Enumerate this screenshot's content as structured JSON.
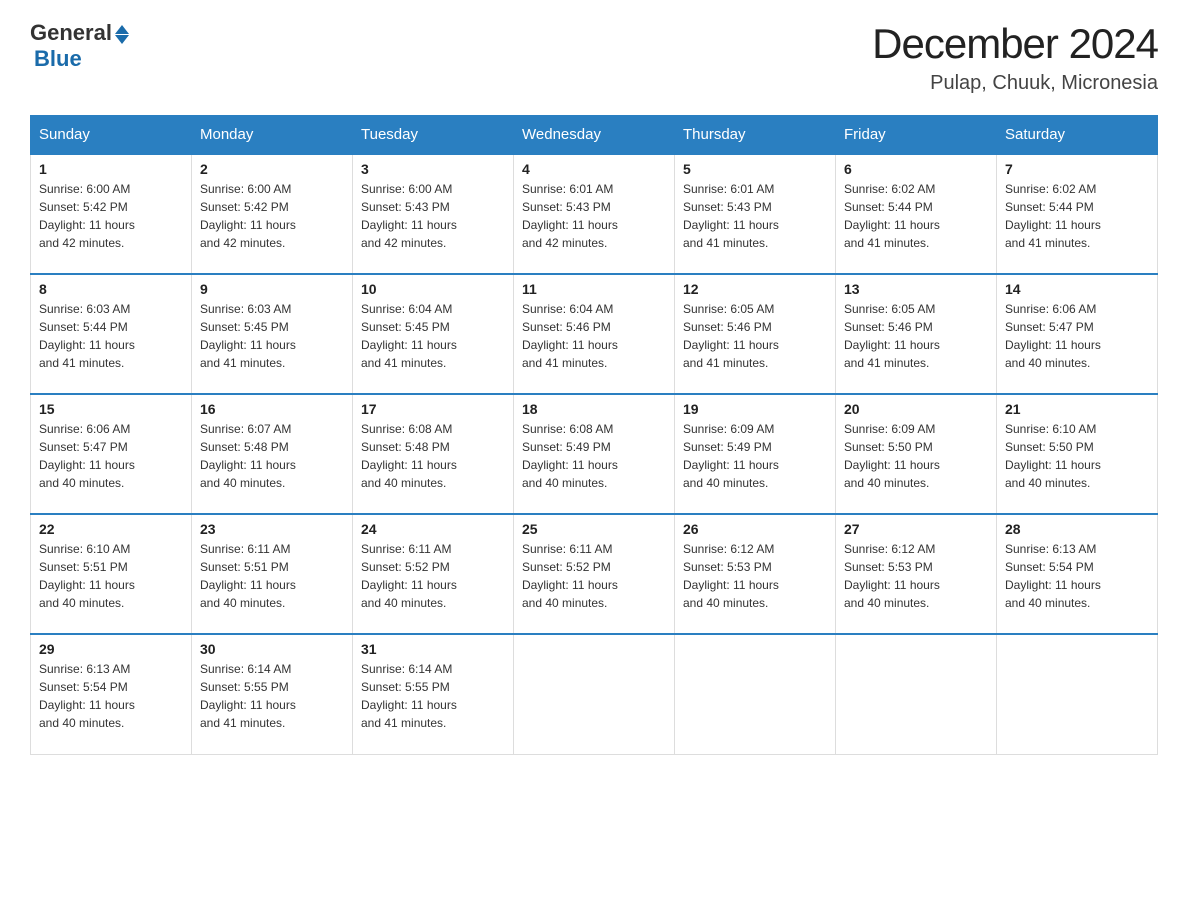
{
  "header": {
    "logo_general": "General",
    "logo_blue": "Blue",
    "month_title": "December 2024",
    "location": "Pulap, Chuuk, Micronesia"
  },
  "weekdays": [
    "Sunday",
    "Monday",
    "Tuesday",
    "Wednesday",
    "Thursday",
    "Friday",
    "Saturday"
  ],
  "weeks": [
    [
      {
        "day": "1",
        "sunrise": "6:00 AM",
        "sunset": "5:42 PM",
        "daylight": "11 hours and 42 minutes."
      },
      {
        "day": "2",
        "sunrise": "6:00 AM",
        "sunset": "5:42 PM",
        "daylight": "11 hours and 42 minutes."
      },
      {
        "day": "3",
        "sunrise": "6:00 AM",
        "sunset": "5:43 PM",
        "daylight": "11 hours and 42 minutes."
      },
      {
        "day": "4",
        "sunrise": "6:01 AM",
        "sunset": "5:43 PM",
        "daylight": "11 hours and 42 minutes."
      },
      {
        "day": "5",
        "sunrise": "6:01 AM",
        "sunset": "5:43 PM",
        "daylight": "11 hours and 41 minutes."
      },
      {
        "day": "6",
        "sunrise": "6:02 AM",
        "sunset": "5:44 PM",
        "daylight": "11 hours and 41 minutes."
      },
      {
        "day": "7",
        "sunrise": "6:02 AM",
        "sunset": "5:44 PM",
        "daylight": "11 hours and 41 minutes."
      }
    ],
    [
      {
        "day": "8",
        "sunrise": "6:03 AM",
        "sunset": "5:44 PM",
        "daylight": "11 hours and 41 minutes."
      },
      {
        "day": "9",
        "sunrise": "6:03 AM",
        "sunset": "5:45 PM",
        "daylight": "11 hours and 41 minutes."
      },
      {
        "day": "10",
        "sunrise": "6:04 AM",
        "sunset": "5:45 PM",
        "daylight": "11 hours and 41 minutes."
      },
      {
        "day": "11",
        "sunrise": "6:04 AM",
        "sunset": "5:46 PM",
        "daylight": "11 hours and 41 minutes."
      },
      {
        "day": "12",
        "sunrise": "6:05 AM",
        "sunset": "5:46 PM",
        "daylight": "11 hours and 41 minutes."
      },
      {
        "day": "13",
        "sunrise": "6:05 AM",
        "sunset": "5:46 PM",
        "daylight": "11 hours and 41 minutes."
      },
      {
        "day": "14",
        "sunrise": "6:06 AM",
        "sunset": "5:47 PM",
        "daylight": "11 hours and 40 minutes."
      }
    ],
    [
      {
        "day": "15",
        "sunrise": "6:06 AM",
        "sunset": "5:47 PM",
        "daylight": "11 hours and 40 minutes."
      },
      {
        "day": "16",
        "sunrise": "6:07 AM",
        "sunset": "5:48 PM",
        "daylight": "11 hours and 40 minutes."
      },
      {
        "day": "17",
        "sunrise": "6:08 AM",
        "sunset": "5:48 PM",
        "daylight": "11 hours and 40 minutes."
      },
      {
        "day": "18",
        "sunrise": "6:08 AM",
        "sunset": "5:49 PM",
        "daylight": "11 hours and 40 minutes."
      },
      {
        "day": "19",
        "sunrise": "6:09 AM",
        "sunset": "5:49 PM",
        "daylight": "11 hours and 40 minutes."
      },
      {
        "day": "20",
        "sunrise": "6:09 AM",
        "sunset": "5:50 PM",
        "daylight": "11 hours and 40 minutes."
      },
      {
        "day": "21",
        "sunrise": "6:10 AM",
        "sunset": "5:50 PM",
        "daylight": "11 hours and 40 minutes."
      }
    ],
    [
      {
        "day": "22",
        "sunrise": "6:10 AM",
        "sunset": "5:51 PM",
        "daylight": "11 hours and 40 minutes."
      },
      {
        "day": "23",
        "sunrise": "6:11 AM",
        "sunset": "5:51 PM",
        "daylight": "11 hours and 40 minutes."
      },
      {
        "day": "24",
        "sunrise": "6:11 AM",
        "sunset": "5:52 PM",
        "daylight": "11 hours and 40 minutes."
      },
      {
        "day": "25",
        "sunrise": "6:11 AM",
        "sunset": "5:52 PM",
        "daylight": "11 hours and 40 minutes."
      },
      {
        "day": "26",
        "sunrise": "6:12 AM",
        "sunset": "5:53 PM",
        "daylight": "11 hours and 40 minutes."
      },
      {
        "day": "27",
        "sunrise": "6:12 AM",
        "sunset": "5:53 PM",
        "daylight": "11 hours and 40 minutes."
      },
      {
        "day": "28",
        "sunrise": "6:13 AM",
        "sunset": "5:54 PM",
        "daylight": "11 hours and 40 minutes."
      }
    ],
    [
      {
        "day": "29",
        "sunrise": "6:13 AM",
        "sunset": "5:54 PM",
        "daylight": "11 hours and 40 minutes."
      },
      {
        "day": "30",
        "sunrise": "6:14 AM",
        "sunset": "5:55 PM",
        "daylight": "11 hours and 41 minutes."
      },
      {
        "day": "31",
        "sunrise": "6:14 AM",
        "sunset": "5:55 PM",
        "daylight": "11 hours and 41 minutes."
      },
      null,
      null,
      null,
      null
    ]
  ],
  "labels": {
    "sunrise_prefix": "Sunrise: ",
    "sunset_prefix": "Sunset: ",
    "daylight_prefix": "Daylight: "
  }
}
